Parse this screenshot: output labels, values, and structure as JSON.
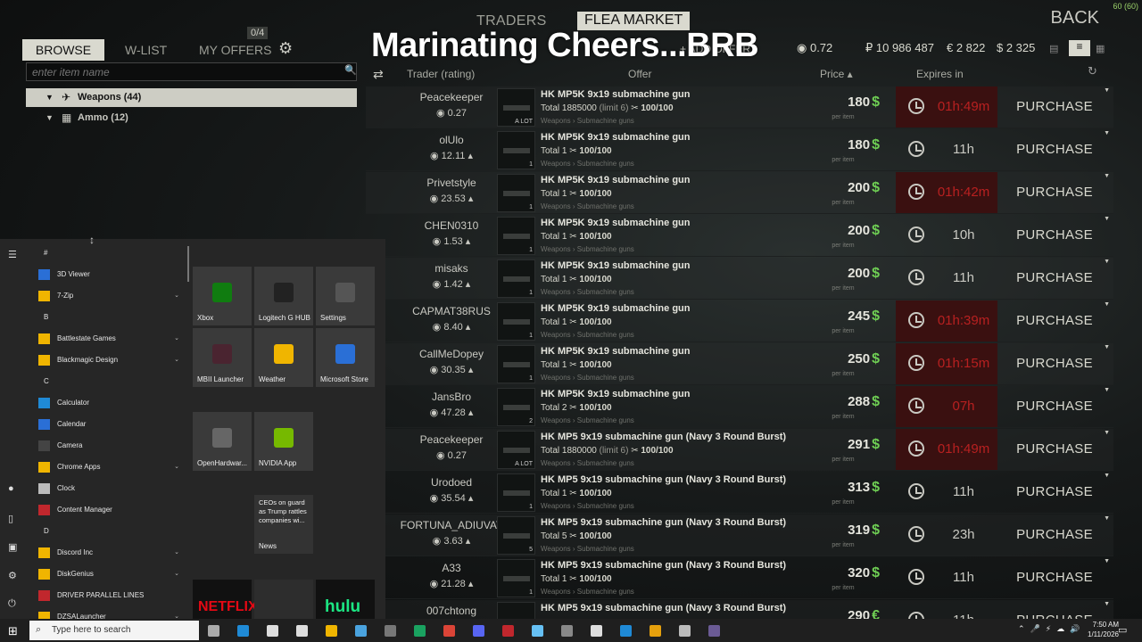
{
  "overlay": {
    "fps": "60 (60)",
    "stream_text": "Marinating Cheers...BRB"
  },
  "header": {
    "traders_tab": "TRADERS",
    "flea_tab": "FLEA MARKET",
    "back": "BACK",
    "rating": "0.72",
    "roubles": "₽ 10 986 487",
    "euros": "€ 2 822",
    "dollars": "$ 2 325",
    "add_offer": "+ ADD OFFER"
  },
  "nav": {
    "browse": "BROWSE",
    "wlist": "W-LIST",
    "my_offers": "MY OFFERS",
    "offers_count": "0/4"
  },
  "search": {
    "placeholder": "enter item name"
  },
  "categories": [
    {
      "label": "Weapons (44)"
    },
    {
      "label": "Ammo (12)"
    }
  ],
  "columns": {
    "trader": "Trader (rating)",
    "offer": "Offer",
    "price": "Price ▴",
    "expires": "Expires in"
  },
  "offers": [
    {
      "trader": "Peacekeeper",
      "rating": "0.27",
      "item": "HK MP5K 9x19 submachine gun",
      "total": "Total 1885000",
      "limit": "(limit 6)",
      "dur": "100/100",
      "cat": "Weapons › Submachine guns",
      "price": "180",
      "cur": "$",
      "per": "per item",
      "exp": "01h:49m",
      "red": true,
      "cnt": "A LOT",
      "action": "PURCHASE"
    },
    {
      "trader": "olUlo",
      "rating": "12.11 ▴",
      "item": "HK MP5K 9x19 submachine gun",
      "total": "Total 1",
      "limit": "",
      "dur": "100/100",
      "cat": "Weapons › Submachine guns",
      "price": "180",
      "cur": "$",
      "per": "per item",
      "exp": "11h",
      "red": false,
      "cnt": "1",
      "action": "PURCHASE"
    },
    {
      "trader": "Privetstyle",
      "rating": "23.53 ▴",
      "item": "HK MP5K 9x19 submachine gun",
      "total": "Total 1",
      "limit": "",
      "dur": "100/100",
      "cat": "Weapons › Submachine guns",
      "price": "200",
      "cur": "$",
      "per": "per item",
      "exp": "01h:42m",
      "red": true,
      "cnt": "1",
      "action": "PURCHASE"
    },
    {
      "trader": "CHEN0310",
      "rating": "1.53 ▴",
      "item": "HK MP5K 9x19 submachine gun",
      "total": "Total 1",
      "limit": "",
      "dur": "100/100",
      "cat": "Weapons › Submachine guns",
      "price": "200",
      "cur": "$",
      "per": "per item",
      "exp": "10h",
      "red": false,
      "cnt": "1",
      "action": "PURCHASE"
    },
    {
      "trader": "misaks",
      "rating": "1.42 ▴",
      "item": "HK MP5K 9x19 submachine gun",
      "total": "Total 1",
      "limit": "",
      "dur": "100/100",
      "cat": "Weapons › Submachine guns",
      "price": "200",
      "cur": "$",
      "per": "per item",
      "exp": "11h",
      "red": false,
      "cnt": "1",
      "action": "PURCHASE"
    },
    {
      "trader": "CAPMAT38RUS",
      "rating": "8.40 ▴",
      "item": "HK MP5K 9x19 submachine gun",
      "total": "Total 1",
      "limit": "",
      "dur": "100/100",
      "cat": "Weapons › Submachine guns",
      "price": "245",
      "cur": "$",
      "per": "per item",
      "exp": "01h:39m",
      "red": true,
      "cnt": "1",
      "action": "PURCHASE"
    },
    {
      "trader": "CallMeDopey",
      "rating": "30.35 ▴",
      "item": "HK MP5K 9x19 submachine gun",
      "total": "Total 1",
      "limit": "",
      "dur": "100/100",
      "cat": "Weapons › Submachine guns",
      "price": "250",
      "cur": "$",
      "per": "per item",
      "exp": "01h:15m",
      "red": true,
      "cnt": "1",
      "action": "PURCHASE"
    },
    {
      "trader": "JansBro",
      "rating": "47.28 ▴",
      "item": "HK MP5K 9x19 submachine gun",
      "total": "Total 2",
      "limit": "",
      "dur": "100/100",
      "cat": "Weapons › Submachine guns",
      "price": "288",
      "cur": "$",
      "per": "per item",
      "exp": "07h",
      "red": true,
      "cnt": "2",
      "action": "PURCHASE"
    },
    {
      "trader": "Peacekeeper",
      "rating": "0.27",
      "item": "HK MP5 9x19 submachine gun (Navy 3 Round Burst)",
      "total": "Total 1880000",
      "limit": "(limit 6)",
      "dur": "100/100",
      "cat": "Weapons › Submachine guns",
      "price": "291",
      "cur": "$",
      "per": "per item",
      "exp": "01h:49m",
      "red": true,
      "cnt": "A LOT",
      "action": "PURCHASE"
    },
    {
      "trader": "Urodoed",
      "rating": "35.54 ▴",
      "item": "HK MP5 9x19 submachine gun (Navy 3 Round Burst)",
      "total": "Total 1",
      "limit": "",
      "dur": "100/100",
      "cat": "Weapons › Submachine guns",
      "price": "313",
      "cur": "$",
      "per": "per item",
      "exp": "11h",
      "red": false,
      "cnt": "1",
      "action": "PURCHASE"
    },
    {
      "trader": "FORTUNA_ADIUVAT",
      "rating": "3.63 ▴",
      "item": "HK MP5 9x19 submachine gun (Navy 3 Round Burst)",
      "total": "Total 5",
      "limit": "",
      "dur": "100/100",
      "cat": "Weapons › Submachine guns",
      "price": "319",
      "cur": "$",
      "per": "per item",
      "exp": "23h",
      "red": false,
      "cnt": "5",
      "action": "PURCHASE"
    },
    {
      "trader": "A33",
      "rating": "21.28 ▴",
      "item": "HK MP5 9x19 submachine gun (Navy 3 Round Burst)",
      "total": "Total 1",
      "limit": "",
      "dur": "100/100",
      "cat": "Weapons › Submachine guns",
      "price": "320",
      "cur": "$",
      "per": "per item",
      "exp": "11h",
      "red": false,
      "cnt": "1",
      "action": "PURCHASE"
    },
    {
      "trader": "007chtong",
      "rating": "",
      "item": "HK MP5 9x19 submachine gun (Navy 3 Round Burst)",
      "total": "",
      "limit": "",
      "dur": "",
      "cat": "",
      "price": "290",
      "cur": "€",
      "per": "",
      "exp": "11h",
      "red": false,
      "cnt": "",
      "action": "PURCHASE"
    }
  ],
  "start_menu": {
    "letters": [
      "#",
      "B",
      "C",
      "D"
    ],
    "apps": [
      "3D Viewer",
      "7-Zip",
      "Battlestate Games",
      "Blackmagic Design",
      "Calculator",
      "Calendar",
      "Camera",
      "Chrome Apps",
      "Clock",
      "Content Manager",
      "Discord Inc",
      "DiskGenius",
      "DRIVER PARALLEL LINES",
      "DZSALauncher"
    ],
    "tiles": [
      "Xbox",
      "Logitech G HUB",
      "Settings",
      "MBII Launcher",
      "Weather",
      "Microsoft Store",
      "OpenHardwar...",
      "NVIDIA App",
      "News"
    ],
    "news_text": "CEOs on guard as Trump rattles companies wi...",
    "netflix": "NETFLIX",
    "hulu": "hulu"
  },
  "taskbar": {
    "search": "Type here to search",
    "time": "7:50 AM",
    "date": "1/11/2026"
  }
}
